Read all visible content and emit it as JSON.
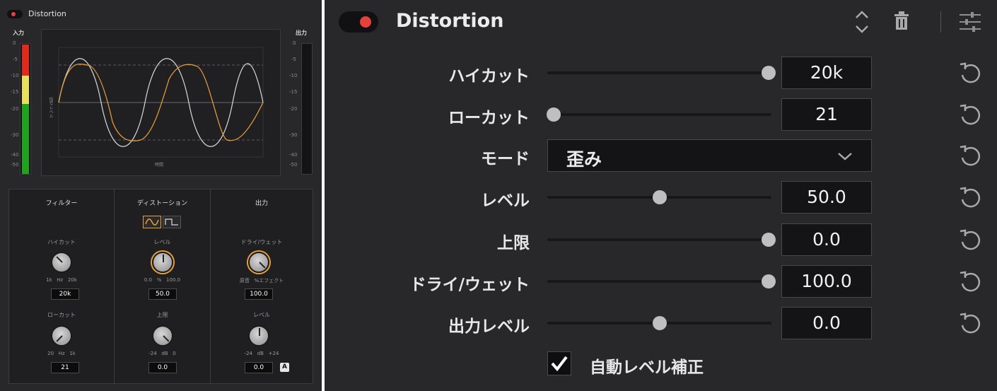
{
  "compact": {
    "title": "Distortion",
    "input_label": "入力",
    "output_label": "出力",
    "scale": [
      "0",
      "-5",
      "-10",
      "-15",
      "-20",
      "-30",
      "-40",
      "-50"
    ],
    "output_scale": [
      "0",
      "-5",
      "-10",
      "-15",
      "-20",
      "-30",
      "-40",
      "-50"
    ],
    "scope_y_label": "信号レベル",
    "scope_x_label": "時間",
    "filter": {
      "title": "フィルター",
      "highcut_label": "ハイカット",
      "highcut_range": "1k   Hz   20k",
      "highcut_value": "20k",
      "lowcut_label": "ローカット",
      "lowcut_range": "20   Hz   1k",
      "lowcut_value": "21"
    },
    "distortion": {
      "title": "ディストーション",
      "level_label": "レベル",
      "level_range": "0.0   %   100.0",
      "level_value": "50.0",
      "ceiling_label": "上限",
      "ceiling_range": "-24   dB   0",
      "ceiling_value": "0.0"
    },
    "output": {
      "title": "出力",
      "drywet_label": "ドライ/ウェット",
      "drywet_range": "原音   %エフェクト",
      "drywet_value": "100.0",
      "level_label": "レベル",
      "level_range": "-24   dB   +24",
      "level_value": "0.0",
      "auto_badge": "A"
    }
  },
  "expanded": {
    "title": "Distortion",
    "rows": [
      {
        "label": "ハイカット",
        "value": "20k",
        "slider": 1.0
      },
      {
        "label": "ローカット",
        "value": "21",
        "slider": 0.0
      },
      {
        "label": "モード",
        "value": "歪み"
      },
      {
        "label": "レベル",
        "value": "50.0",
        "slider": 0.5
      },
      {
        "label": "上限",
        "value": "0.0",
        "slider": 1.0
      },
      {
        "label": "ドライ/ウェット",
        "value": "100.0",
        "slider": 1.0
      },
      {
        "label": "出力レベル",
        "value": "0.0",
        "slider": 0.5
      }
    ],
    "auto_level_label": "自動レベル補正",
    "auto_level_checked": true
  },
  "colors": {
    "accent_orange": "#e9a23b",
    "toggle_red": "#e8403a",
    "meter_green": "#1fa31f",
    "meter_yellow": "#e8e05a",
    "meter_red": "#e02a1c"
  }
}
